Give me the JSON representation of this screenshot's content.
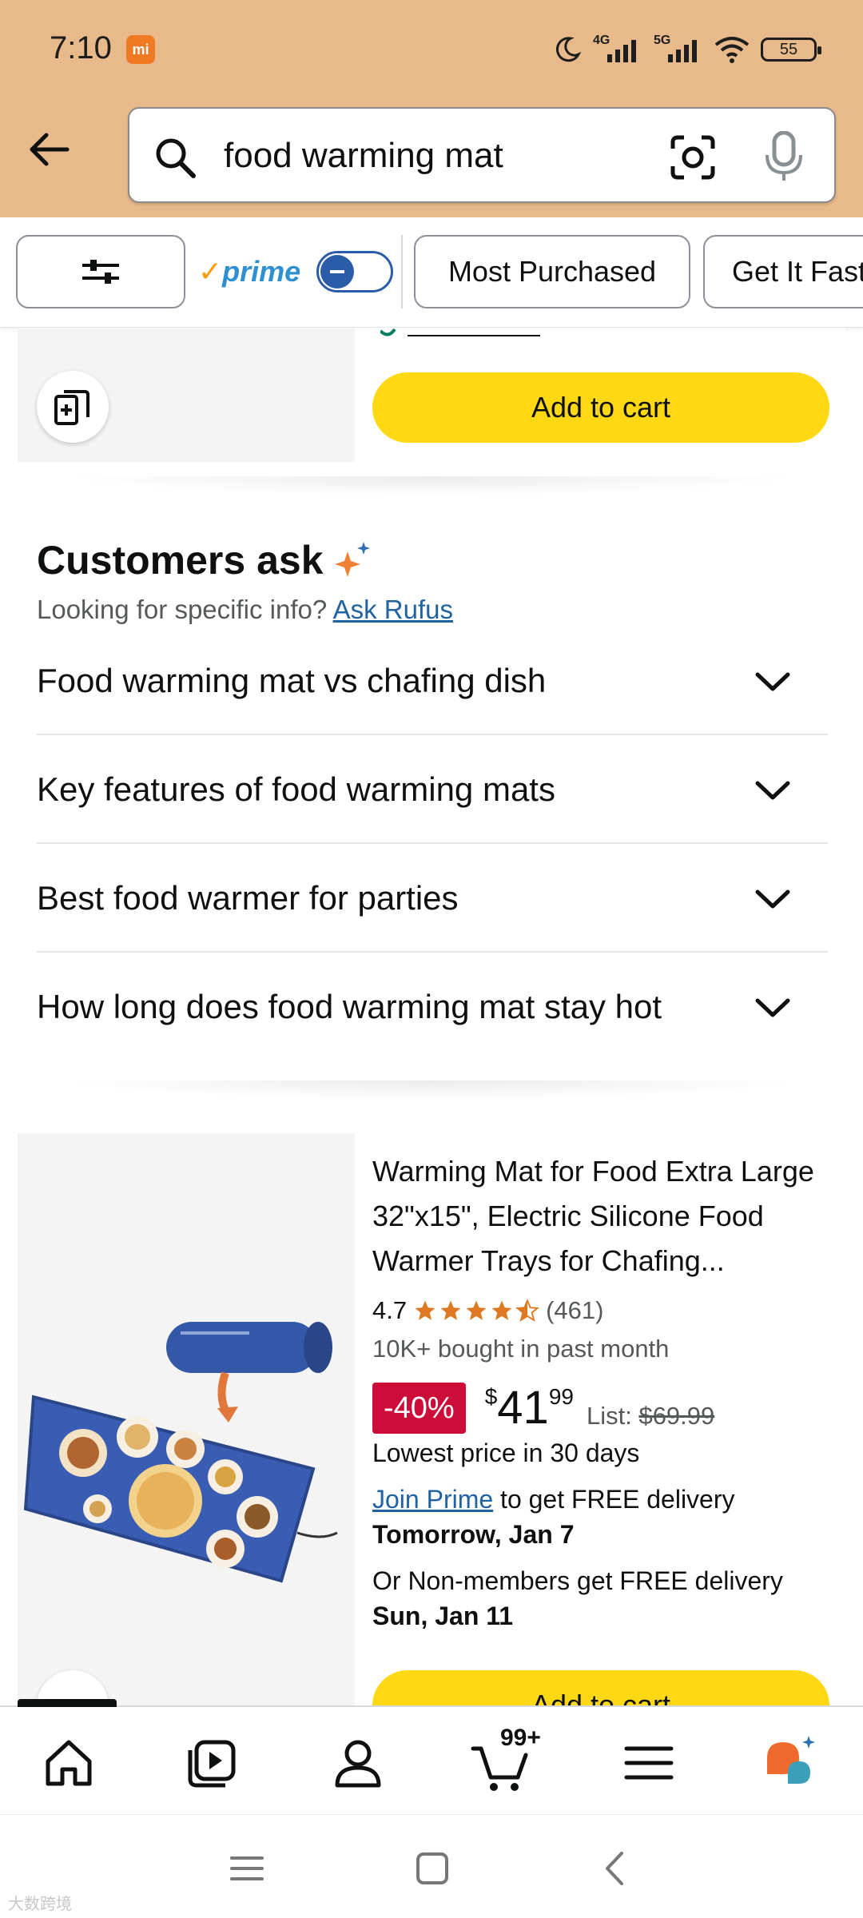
{
  "status_bar": {
    "time": "7:10",
    "carrier_badge": "mi",
    "signal_1": "4G",
    "signal_2": "5G",
    "battery": "55"
  },
  "search": {
    "query": "food warming mat"
  },
  "filters": {
    "prime_label": "prime",
    "chips": [
      "Most Purchased",
      "Get It Fast"
    ]
  },
  "top_card": {
    "add_to_cart": "Add to cart"
  },
  "customers_ask": {
    "title": "Customers ask",
    "subtitle": "Looking for specific info?",
    "link": "Ask Rufus",
    "questions": [
      "Food warming mat vs chafing dish",
      "Key features of food warming mats",
      "Best food warmer for parties",
      "How long does food warming mat stay hot"
    ]
  },
  "product": {
    "title": "Warming Mat for Food Extra Large 32\"x15\", Electric Silicone Food Warmer Trays for Chafing...",
    "rating": "4.7",
    "rating_value": 4.7,
    "review_count": "(461)",
    "bought": "10K+ bought in past month",
    "discount": "-40%",
    "price_currency": "$",
    "price_whole": "41",
    "price_fraction": "99",
    "list_label": "List:",
    "list_price": "$69.99",
    "lowest": "Lowest price in 30 days",
    "join_prime": "Join Prime",
    "prime_delivery": " to get FREE delivery",
    "prime_date": "Tomorrow, Jan 7",
    "nonmember_delivery": "Or Non-members get FREE delivery",
    "nonmember_date": "Sun, Jan 11",
    "add_to_cart": "Add to cart"
  },
  "bottom_nav": {
    "cart_count": "99+"
  },
  "watermark": "大数跨境",
  "colors": {
    "header_bg": "#e8b98a",
    "atc_yellow": "#ffd814",
    "discount_red": "#cc0c39",
    "link_blue": "#2162a1",
    "star_orange": "#de7921"
  }
}
